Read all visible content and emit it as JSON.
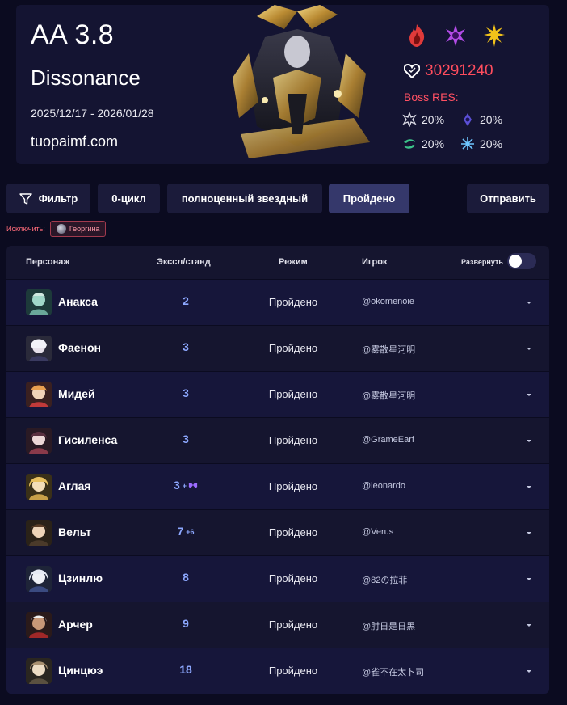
{
  "header": {
    "title": "AA 3.8",
    "subtitle": "Dissonance",
    "dates": "2025/12/17 - 2026/01/28",
    "site": "tuopaimf.com",
    "elements": [
      "fire-icon",
      "imaginary-icon",
      "physical-icon"
    ],
    "hp": "30291240",
    "res_title": "Boss RES:",
    "res": [
      {
        "icon": "physical-res-icon",
        "value": "20%"
      },
      {
        "icon": "quantum-res-icon",
        "value": "20%"
      },
      {
        "icon": "wind-res-icon",
        "value": "20%"
      },
      {
        "icon": "ice-res-icon",
        "value": "20%"
      }
    ]
  },
  "filters": {
    "filter_label": "Фильтр",
    "cycle_label": "0-цикл",
    "star_label": "полноценный звездный",
    "passed_label": "Пройдено",
    "submit_label": "Отправить"
  },
  "exclude": {
    "label": "Исключить:",
    "chip": "Георгина"
  },
  "table": {
    "headers": {
      "character": "Персонаж",
      "count": "Эксcл/станд",
      "mode": "Режим",
      "player": "Игрок",
      "expand": "Развернуть"
    },
    "rows": [
      {
        "name": "Анакса",
        "count": "2",
        "extra": "",
        "mode": "Пройдено",
        "player": "@okomenoie"
      },
      {
        "name": "Фаенон",
        "count": "3",
        "extra": "",
        "mode": "Пройдено",
        "player": "@雾散星河明"
      },
      {
        "name": "Мидей",
        "count": "3",
        "extra": "",
        "mode": "Пройдено",
        "player": "@雾散星河明"
      },
      {
        "name": "Гисиленса",
        "count": "3",
        "extra": "",
        "mode": "Пройдено",
        "player": "@GrameEarf"
      },
      {
        "name": "Аглая",
        "count": "3",
        "extra": "+",
        "mode": "Пройдено",
        "player": "@leonardo"
      },
      {
        "name": "Вельт",
        "count": "7",
        "extra": "+6",
        "mode": "Пройдено",
        "player": "@Verus"
      },
      {
        "name": "Цзинлю",
        "count": "8",
        "extra": "",
        "mode": "Пройдено",
        "player": "@82の拉菲"
      },
      {
        "name": "Арчер",
        "count": "9",
        "extra": "",
        "mode": "Пройдено",
        "player": "@肘日是日黑"
      },
      {
        "name": "Цинцюэ",
        "count": "18",
        "extra": "",
        "mode": "Пройдено",
        "player": "@雀不在太卜司"
      }
    ]
  },
  "colors": {
    "background": "#0b0b20",
    "card": "#141432",
    "accent_blue": "#8da8ff",
    "hp_red": "#ff4d5e",
    "active_button": "#35386b"
  }
}
